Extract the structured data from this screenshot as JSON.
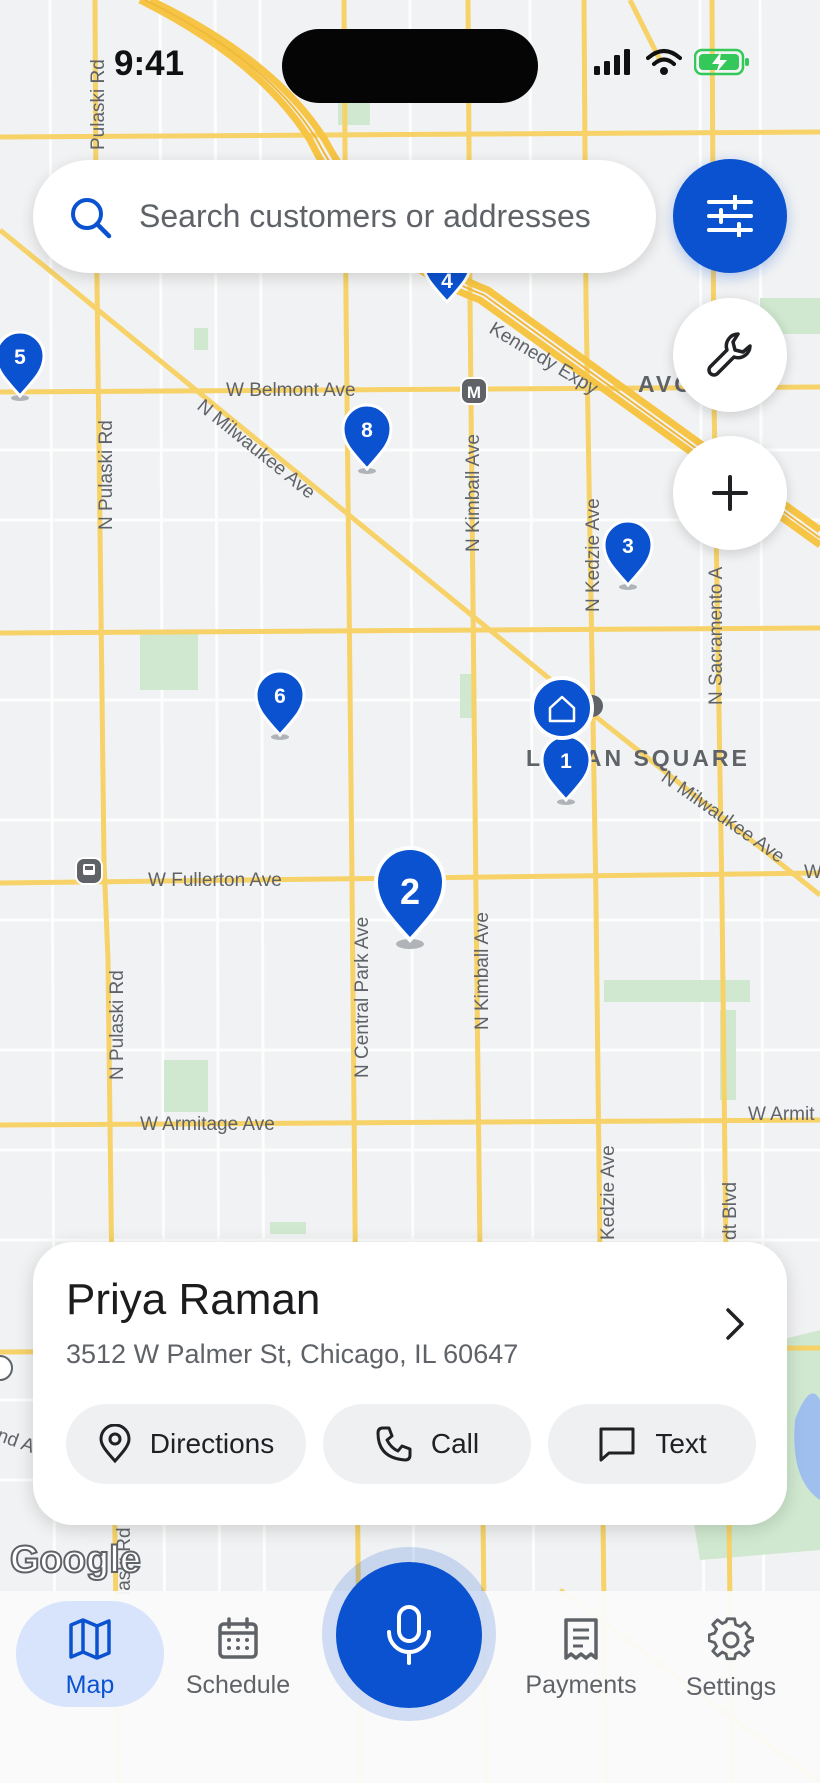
{
  "status_bar": {
    "time": "9:41"
  },
  "search": {
    "placeholder": "Search customers or addresses",
    "icon": "search-icon"
  },
  "map": {
    "streets": {
      "pulaski_top": "Pulaski Rd",
      "pulaski": "N Pulaski Rd",
      "pulaski_lower": "N Pulaski Rd",
      "pulaski_bottom": "laski Rd",
      "belmont": "W Belmont Ave",
      "milwaukee_upper": "N Milwaukee Ave",
      "kimball_upper": "N Kimball Ave",
      "kimball_lower": "N Kimball Ave",
      "kedzie_upper": "N Kedzie Ave",
      "kedzie_lower": "Kedzie Ave",
      "sacramento": "N Sacramento A",
      "kennedy": "Kennedy Expy",
      "avondale": "AVC",
      "fullerton": "W Fullerton Ave",
      "fullerton_right": "W",
      "central_park": "N Central Park Ave",
      "milwaukee_lower": "N Milwaukee Ave",
      "armitage": "W Armitage Ave",
      "armitage_right": "W Armit",
      "california": "dt Blvd",
      "edge_left": "nd A"
    },
    "neighborhood": "LOGAN SQUARE",
    "transit_badge": "M",
    "pins": [
      "1",
      "2",
      "3",
      "4",
      "5",
      "6",
      "8"
    ],
    "home_icon": "home-icon",
    "attribution": "Google"
  },
  "tools": {
    "filter": "sliders-icon",
    "tool": "wrench-icon",
    "add": "plus-icon"
  },
  "card": {
    "name": "Priya Raman",
    "address": "3512 W Palmer St, Chicago, IL 60647",
    "actions": {
      "directions": "Directions",
      "call": "Call",
      "text": "Text"
    }
  },
  "nav": {
    "map": "Map",
    "schedule": "Schedule",
    "payments": "Payments",
    "settings": "Settings",
    "active": "Map",
    "mic": "microphone-icon"
  },
  "colors": {
    "accent": "#0b52d0",
    "road": "#f6d268",
    "map_bg": "#f1f2f3",
    "park": "#cfe8cf"
  }
}
